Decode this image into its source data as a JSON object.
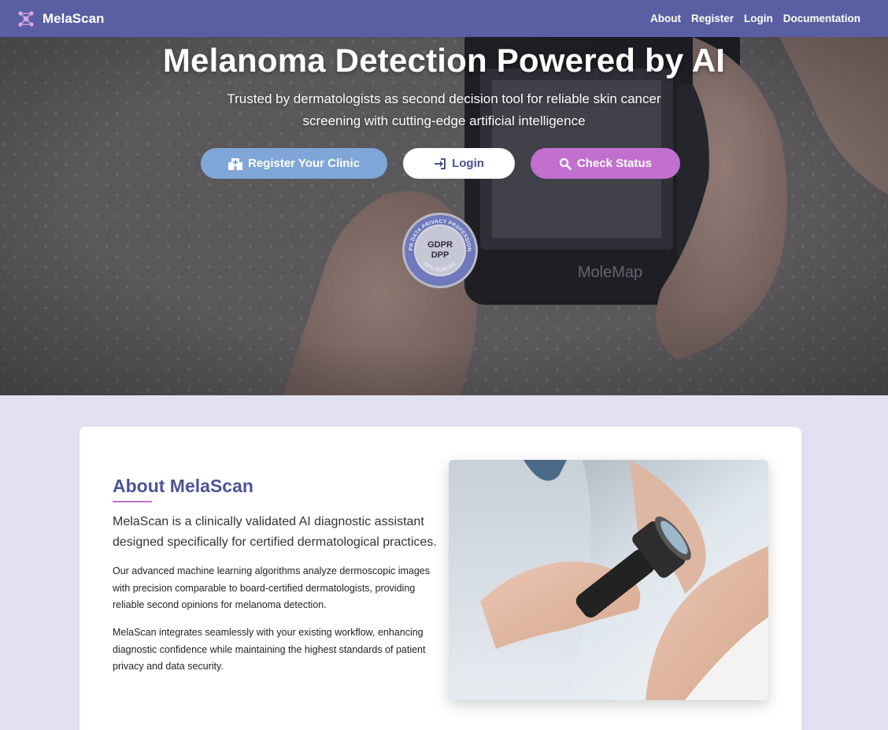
{
  "nav": {
    "brand": "MelaScan",
    "links": [
      "About",
      "Register",
      "Login",
      "Documentation"
    ]
  },
  "hero": {
    "title": "Melanoma Detection Powered by AI",
    "subtitle": "Trusted by dermatologists as second decision tool for reliable skin cancer screening with cutting-edge artificial intelligence",
    "buttons": {
      "register": "Register Your Clinic",
      "login": "Login",
      "status": "Check Status"
    },
    "badge": {
      "line1": "GDPR",
      "line2": "DPP",
      "ring_top": "GDPR DATA PRIVACY PROFESSIONAL",
      "ring_bottom": "DPO EUROPE"
    },
    "device_label": "MoleMap"
  },
  "about": {
    "title": "About MelaScan",
    "lead": "MelaScan is a clinically validated AI diagnostic assistant designed specifically for certified dermatological practices.",
    "p1": "Our advanced machine learning algorithms analyze dermoscopic images with precision comparable to board-certified dermatologists, providing reliable second opinions for melanoma detection.",
    "p2": "MelaScan integrates seamlessly with your existing workflow, enhancing diagnostic confidence while maintaining the highest standards of patient privacy and data security."
  },
  "colors": {
    "nav": "#5a5fa3",
    "register_btn": "#7fa6d6",
    "status_btn": "#c270cf",
    "about_title": "#4e5396",
    "page_bg": "#e2e1f1"
  },
  "icons": {
    "brand": "molecule-icon",
    "register": "hospital-icon",
    "login": "sign-in-icon",
    "status": "search-icon"
  }
}
